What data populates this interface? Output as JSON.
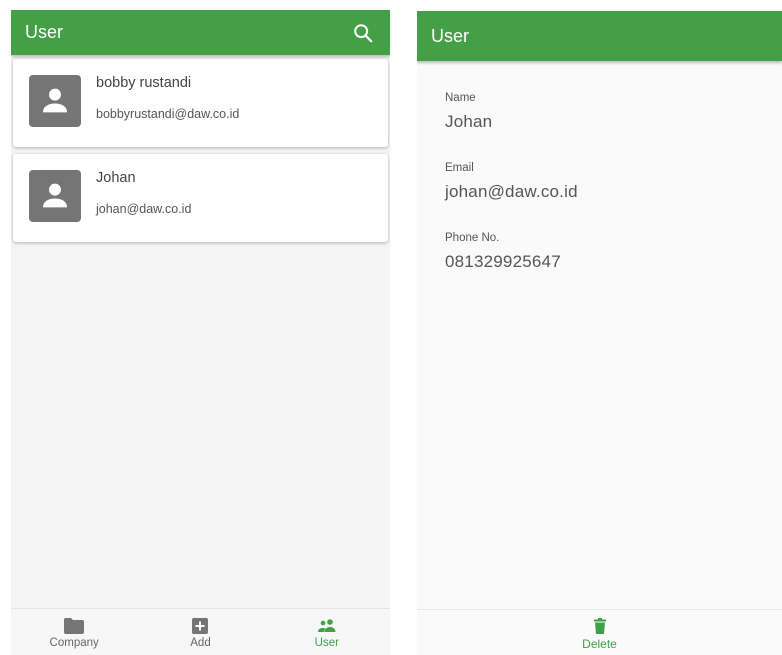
{
  "left": {
    "appbar": {
      "title": "User",
      "search_icon": "search-icon"
    },
    "users": [
      {
        "name": "bobby rustandi",
        "email": "bobbyrustandi@daw.co.id",
        "avatar_icon": "person-icon"
      },
      {
        "name": "Johan",
        "email": "johan@daw.co.id",
        "avatar_icon": "person-icon"
      }
    ],
    "bottom_nav": [
      {
        "label": "Company",
        "icon": "folder-icon",
        "active": false
      },
      {
        "label": "Add",
        "icon": "add-box-icon",
        "active": false
      },
      {
        "label": "User",
        "icon": "people-icon",
        "active": true
      }
    ]
  },
  "right": {
    "appbar": {
      "title": "User"
    },
    "fields": {
      "name": {
        "label": "Name",
        "value": "Johan"
      },
      "email": {
        "label": "Email",
        "value": "johan@daw.co.id"
      },
      "phone": {
        "label": "Phone No.",
        "value": "081329925647"
      }
    },
    "delete": {
      "label": "Delete",
      "icon": "trash-icon"
    }
  },
  "colors": {
    "primary": "#43a047",
    "avatar_bg": "#757575",
    "nav_icon": "#757575"
  }
}
